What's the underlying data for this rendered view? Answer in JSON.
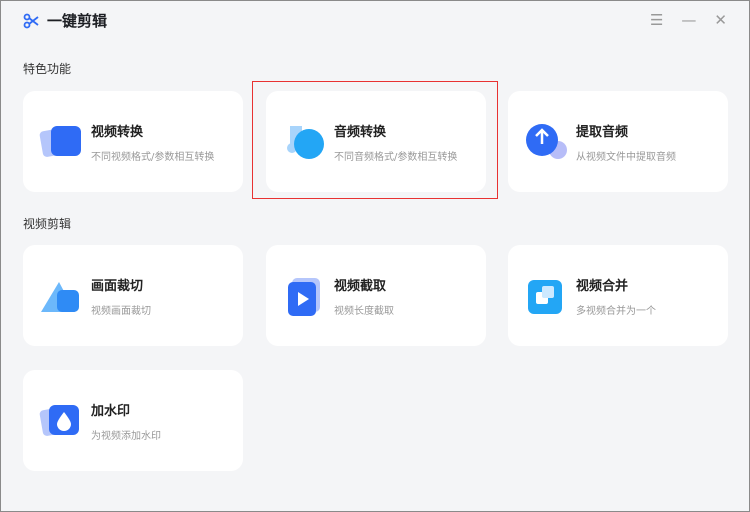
{
  "app": {
    "title": "一键剪辑"
  },
  "window": {
    "menu": "☰",
    "minimize": "—",
    "close": "✕"
  },
  "sections": [
    {
      "label": "特色功能",
      "items": [
        {
          "name": "视频转换",
          "desc": "不同视频格式/参数相互转换",
          "icon": "video-convert-icon"
        },
        {
          "name": "音频转换",
          "desc": "不同音频格式/参数相互转换",
          "icon": "audio-convert-icon"
        },
        {
          "name": "提取音频",
          "desc": "从视频文件中提取音频",
          "icon": "extract-audio-icon"
        }
      ]
    },
    {
      "label": "视频剪辑",
      "items": [
        {
          "name": "画面裁切",
          "desc": "视频画面裁切",
          "icon": "crop-icon"
        },
        {
          "name": "视频截取",
          "desc": "视频长度截取",
          "icon": "trim-icon"
        },
        {
          "name": "视频合并",
          "desc": "多视频合并为一个",
          "icon": "merge-icon"
        },
        {
          "name": "加水印",
          "desc": "为视频添加水印",
          "icon": "watermark-icon"
        }
      ]
    }
  ],
  "colors": {
    "accent": "#2f6bf5",
    "highlight": "#e83232"
  }
}
